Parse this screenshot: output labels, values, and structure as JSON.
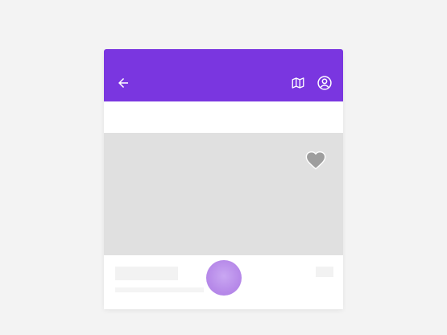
{
  "colors": {
    "appbar": "#7a36e0",
    "media_placeholder": "#e0e0e0",
    "fab": "#b78ae9",
    "icon": "#ffffff",
    "heart": "#9e9e9e"
  },
  "appbar": {
    "icons": {
      "back": "arrow-left-icon",
      "map": "map-icon",
      "account": "account-circle-icon"
    }
  },
  "media": {
    "favorite_icon": "heart-icon"
  }
}
